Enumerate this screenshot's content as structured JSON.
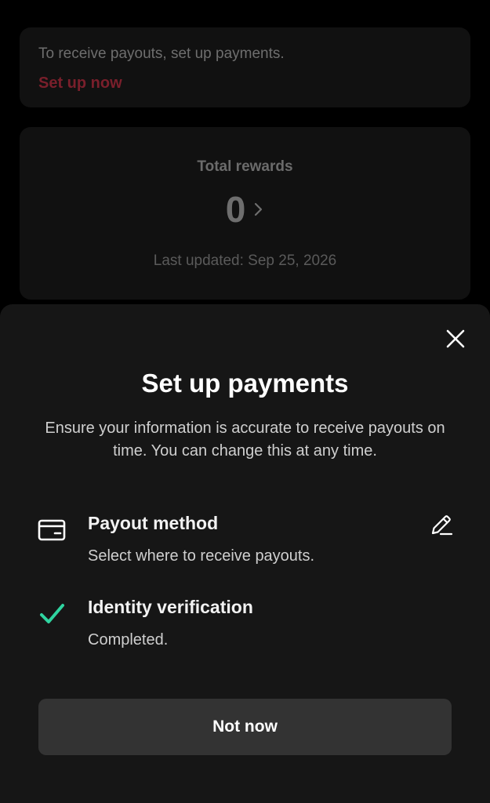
{
  "setup_card": {
    "message": "To receive payouts, set up payments.",
    "link_label": "Set up now"
  },
  "rewards_card": {
    "title": "Total rewards",
    "value": "0",
    "last_updated": "Last updated: Sep 25, 2026"
  },
  "sheet": {
    "title": "Set up payments",
    "description": "Ensure your information is accurate to receive payouts on time. You can change this at any time.",
    "items": [
      {
        "icon": "wallet-icon",
        "title": "Payout method",
        "subtitle": "Select where to receive payouts.",
        "action_icon": "edit-pencil-icon"
      },
      {
        "icon": "checkmark-icon",
        "title": "Identity verification",
        "subtitle": "Completed."
      }
    ],
    "primary_button_label": "Not now",
    "close_icon": "close-icon"
  },
  "colors": {
    "accent_link": "#7a1f2b",
    "check_green": "#2fd4a0",
    "sheet_bg": "#161616",
    "button_bg": "#333333"
  }
}
